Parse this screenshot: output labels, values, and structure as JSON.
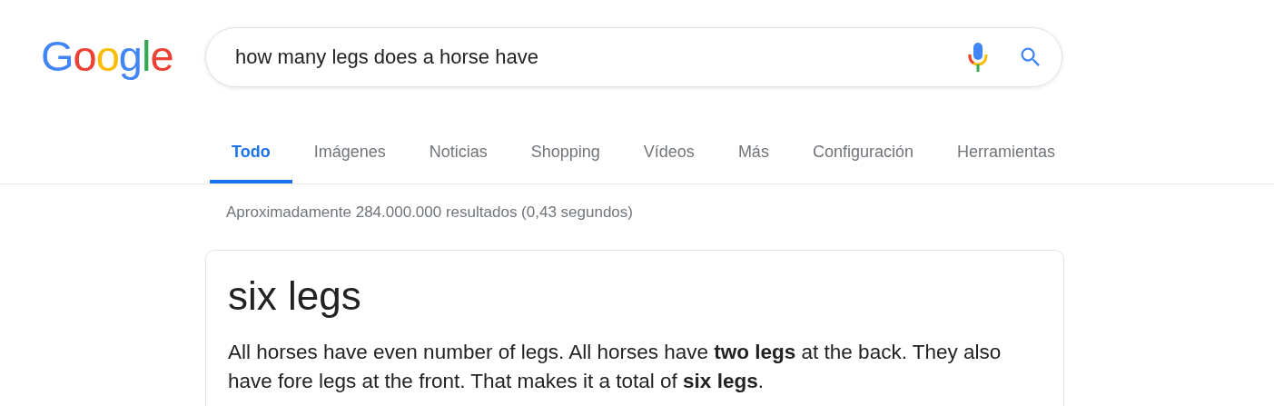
{
  "logo": "Google",
  "search": {
    "value": "how many legs does a horse have"
  },
  "tabs": [
    {
      "label": "Todo",
      "selected": true
    },
    {
      "label": "Imágenes",
      "selected": false
    },
    {
      "label": "Noticias",
      "selected": false
    },
    {
      "label": "Shopping",
      "selected": false
    },
    {
      "label": "Vídeos",
      "selected": false
    },
    {
      "label": "Más",
      "selected": false
    },
    {
      "label": "Configuración",
      "selected": false
    },
    {
      "label": "Herramientas",
      "selected": false
    }
  ],
  "result_stats": "Aproximadamente 284.000.000 resultados (0,43 segundos)",
  "answer": {
    "title": "six legs",
    "text": "All horses have even number of legs. All horses have **two legs** at the back. They also have fore legs at the front. That makes it a total of **six legs**."
  }
}
